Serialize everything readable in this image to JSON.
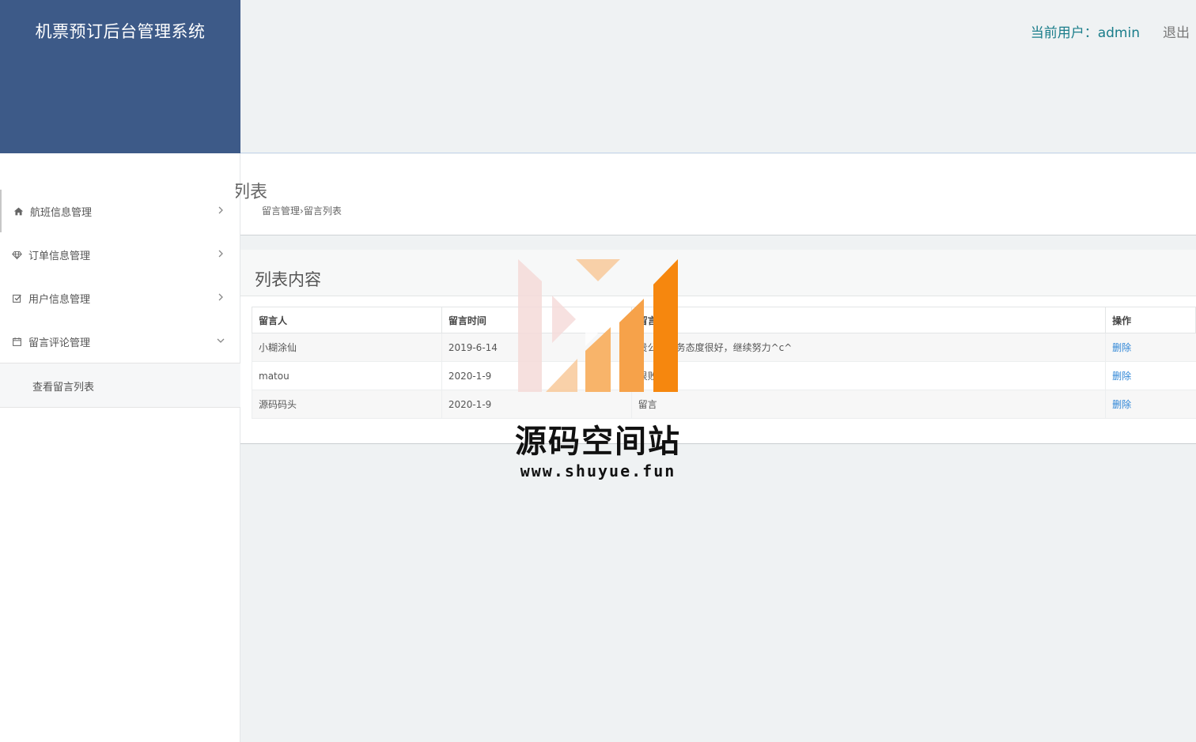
{
  "app": {
    "title": "机票预订后台管理系统"
  },
  "topbar": {
    "user_label": "当前用户：admin",
    "logout_label": "退出"
  },
  "sidebar": {
    "items": [
      {
        "label": "航班信息管理",
        "icon": "home-icon",
        "expanded": false
      },
      {
        "label": "订单信息管理",
        "icon": "diamond-icon",
        "expanded": false
      },
      {
        "label": "用户信息管理",
        "icon": "check-square-icon",
        "expanded": false
      },
      {
        "label": "留言评论管理",
        "icon": "calendar-icon",
        "expanded": true
      }
    ],
    "sub_items": [
      {
        "label": "查看留言列表"
      }
    ]
  },
  "page": {
    "title_fragment": "列表",
    "breadcrumb": [
      "留言管理",
      "留言列表"
    ],
    "breadcrumb_sep": "›"
  },
  "panel": {
    "title": "列表内容"
  },
  "table": {
    "headers": [
      "留言人",
      "留言时间",
      "留言",
      "操作"
    ],
    "rows": [
      {
        "author": "小糊涂仙",
        "time": "2019-6-14",
        "message": "贵公司服务态度很好，继续努力^c^",
        "action": "删除"
      },
      {
        "author": "matou",
        "time": "2020-1-9",
        "message": "很败",
        "action": "删除"
      },
      {
        "author": "源码码头",
        "time": "2020-1-9",
        "message": "留言",
        "action": "删除"
      }
    ]
  },
  "watermark": {
    "name": "源码空间站",
    "url": "www.shuyue.fun",
    "colors": {
      "light": "#f5dad8",
      "mid": "#f8b46a",
      "dark": "#f6870e"
    }
  }
}
